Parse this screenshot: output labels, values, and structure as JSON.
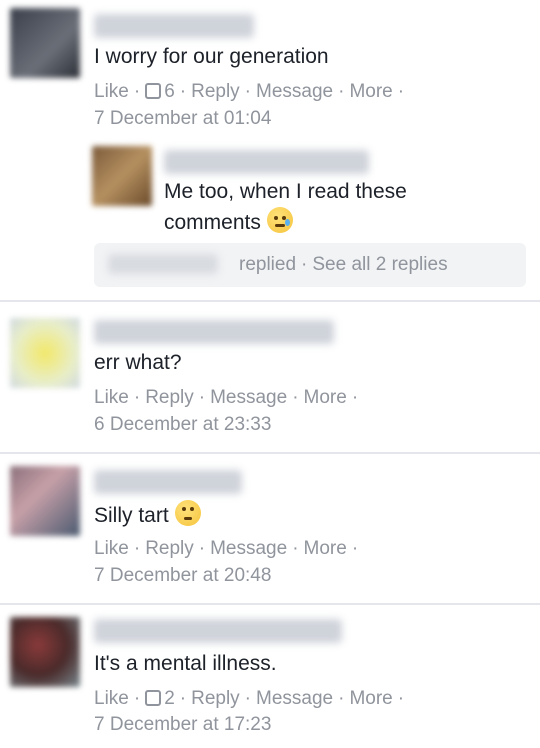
{
  "comments": [
    {
      "text": "I worry for our generation",
      "actions": {
        "like": "Like",
        "like_count": "6",
        "reply": "Reply",
        "message": "Message",
        "more": "More"
      },
      "date": "7 December at 01:04",
      "reply": {
        "text_line1": "Me too, when I read these",
        "text_line2": "comments",
        "emoji": "sad-tear-emoji"
      },
      "replies_bar": {
        "replied": "replied",
        "see_all": "See all 2 replies"
      }
    },
    {
      "text": "err what?",
      "actions": {
        "like": "Like",
        "reply": "Reply",
        "message": "Message",
        "more": "More"
      },
      "date": "6 December at 23:33"
    },
    {
      "text": "Silly tart",
      "emoji": "eye-roll-emoji",
      "actions": {
        "like": "Like",
        "reply": "Reply",
        "message": "Message",
        "more": "More"
      },
      "date": "7 December at 20:48"
    },
    {
      "text": "It's a mental illness.",
      "actions": {
        "like": "Like",
        "like_count": "2",
        "reply": "Reply",
        "message": "Message",
        "more": "More"
      },
      "date": "7 December at 17:23"
    }
  ],
  "colors": {
    "text": "#1d2129",
    "meta": "#90949c",
    "divider": "#e4e6eb",
    "reply_bar": "#f2f3f5"
  }
}
